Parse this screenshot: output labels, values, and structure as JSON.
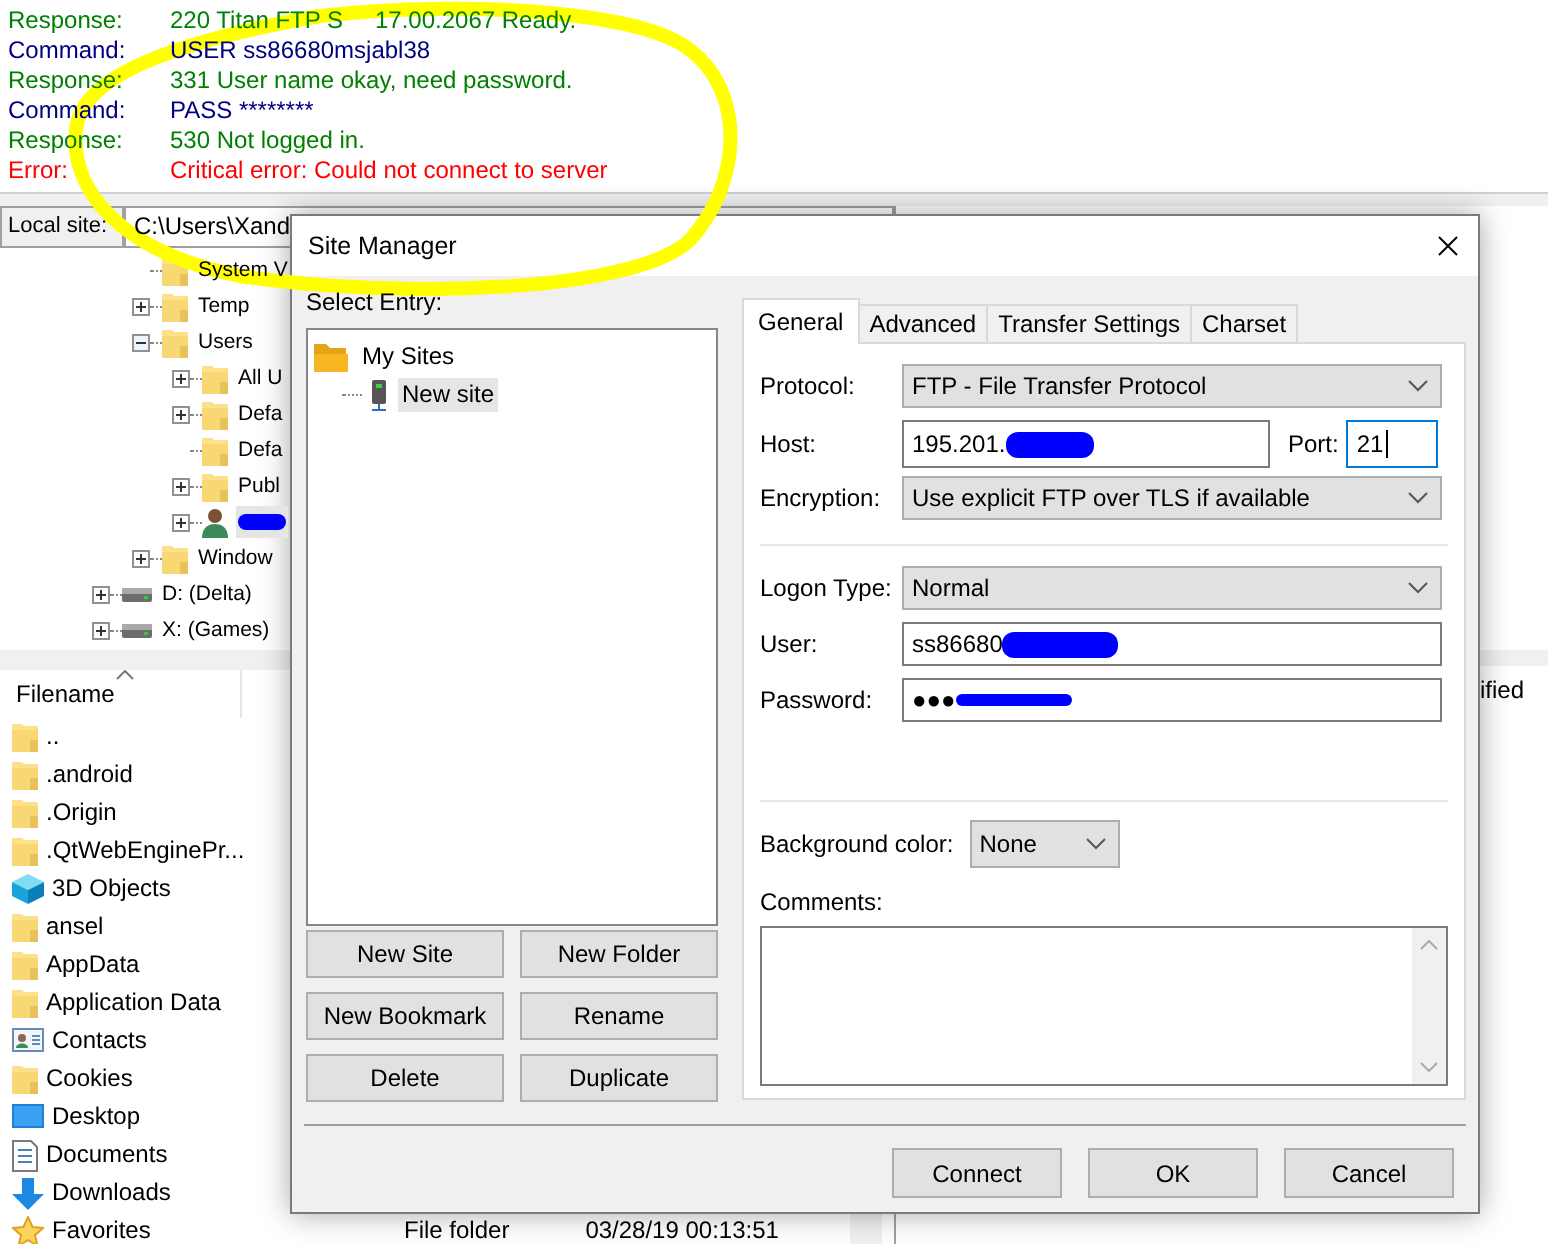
{
  "log": [
    {
      "kind": "response",
      "label": "Response:",
      "message": "220 Titan FTP S",
      "message_tail": "17.00.2067 Ready."
    },
    {
      "kind": "command",
      "label": "Command:",
      "message": "USER ss86680msjabl38"
    },
    {
      "kind": "response",
      "label": "Response:",
      "message": "331 User name okay, need password."
    },
    {
      "kind": "command",
      "label": "Command:",
      "message": "PASS ********"
    },
    {
      "kind": "response",
      "label": "Response:",
      "message": "530 Not logged in."
    },
    {
      "kind": "error",
      "label": "Error:",
      "message": "Critical error: Could not connect to server"
    }
  ],
  "local_site": {
    "label": "Local site:",
    "path": "C:\\Users\\Xand"
  },
  "local_tree": {
    "items": [
      {
        "kind": "folder",
        "label": "System V",
        "expandable": false,
        "selected": false
      },
      {
        "kind": "folder",
        "label": "Temp",
        "expandable": true,
        "expanded": false,
        "selected": false
      },
      {
        "kind": "folder",
        "label": "Users",
        "expandable": true,
        "expanded": true,
        "selected": false,
        "children": [
          {
            "kind": "folder",
            "label": "All U",
            "expandable": true,
            "expanded": false,
            "selected": false
          },
          {
            "kind": "folder",
            "label": "Defa",
            "expandable": true,
            "expanded": false,
            "selected": false
          },
          {
            "kind": "folder",
            "label": "Defa",
            "expandable": false,
            "selected": false
          },
          {
            "kind": "folder",
            "label": "Publ",
            "expandable": true,
            "expanded": false,
            "selected": false
          },
          {
            "kind": "user",
            "redacted": true,
            "expandable": true,
            "expanded": false,
            "selected": true
          }
        ]
      },
      {
        "kind": "folder",
        "label": "Window",
        "expandable": true,
        "expanded": false,
        "selected": false
      }
    ],
    "drives": [
      {
        "kind": "drive",
        "label": "D: (Delta)",
        "expandable": true,
        "expanded": false,
        "selected": false
      },
      {
        "kind": "drive",
        "label": "X: (Games)",
        "expandable": true,
        "expanded": false,
        "selected": false
      }
    ]
  },
  "local_files": {
    "columns": [
      "Filename"
    ],
    "rows": [
      {
        "kind": "folder",
        "name": ".."
      },
      {
        "kind": "folder",
        "name": ".android"
      },
      {
        "kind": "folder",
        "name": ".Origin"
      },
      {
        "kind": "folder",
        "name": ".QtWebEnginePr..."
      },
      {
        "kind": "objects3d",
        "name": "3D Objects"
      },
      {
        "kind": "folder",
        "name": "ansel"
      },
      {
        "kind": "folder",
        "name": "AppData"
      },
      {
        "kind": "folder",
        "name": "Application Data"
      },
      {
        "kind": "contacts",
        "name": "Contacts"
      },
      {
        "kind": "folder",
        "name": "Cookies"
      },
      {
        "kind": "desktop",
        "name": "Desktop"
      },
      {
        "kind": "documents",
        "name": "Documents"
      },
      {
        "kind": "downloads",
        "name": "Downloads"
      },
      {
        "kind": "favorites",
        "name": "Favorites",
        "type": "File folder",
        "modified": "03/28/19 00:13:51"
      }
    ]
  },
  "remote_files": {
    "column_header": "ified"
  },
  "site_manager": {
    "title": "Site Manager",
    "select_entry_label": "Select Entry:",
    "entries": [
      {
        "kind": "folder",
        "label": "My Sites",
        "selected": false,
        "children": [
          {
            "kind": "site",
            "label": "New site",
            "selected": true
          }
        ]
      }
    ],
    "buttons": [
      "New Site",
      "New Folder",
      "New Bookmark",
      "Rename",
      "Delete",
      "Duplicate"
    ],
    "tabs": [
      {
        "label": "General",
        "selected": true
      },
      {
        "label": "Advanced",
        "selected": false
      },
      {
        "label": "Transfer Settings",
        "selected": false
      },
      {
        "label": "Charset",
        "selected": false
      }
    ],
    "connection": [
      {
        "kind": "select",
        "label": "Protocol:",
        "value": "FTP - File Transfer Protocol"
      },
      {
        "kind": "host",
        "label": "Host:",
        "value": "195.201.",
        "redacted": true,
        "port_label": "Port:",
        "port_value": "21",
        "port_focused": true
      },
      {
        "kind": "select",
        "label": "Encryption:",
        "value": "Use explicit FTP over TLS if available"
      }
    ],
    "login": [
      {
        "kind": "select",
        "label": "Logon Type:",
        "value": "Normal"
      },
      {
        "kind": "input",
        "label": "User:",
        "value": "ss86680",
        "redacted": true
      },
      {
        "kind": "input",
        "label": "Password:",
        "value": "●●●",
        "redacted": true
      }
    ],
    "background_color": {
      "label": "Background color:",
      "value": "None"
    },
    "comments": {
      "label": "Comments:"
    },
    "footer_buttons": [
      "Connect",
      "OK",
      "Cancel"
    ]
  }
}
